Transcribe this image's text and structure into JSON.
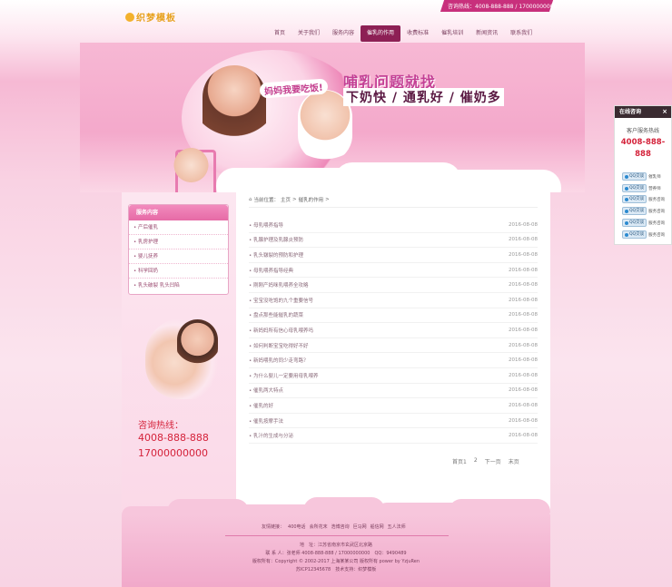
{
  "header": {
    "hotline": "咨询热线：4008-888-888 / 17000000000",
    "logo_text": "织梦模板"
  },
  "nav": [
    {
      "label": "首页"
    },
    {
      "label": "关于我们"
    },
    {
      "label": "服务内容"
    },
    {
      "label": "催乳的作用",
      "active": true
    },
    {
      "label": "收费标准"
    },
    {
      "label": "催乳培训"
    },
    {
      "label": "新闻资讯"
    },
    {
      "label": "联系我们"
    }
  ],
  "banner": {
    "speech": "妈妈我要吃饭!",
    "title": "哺乳问题就找",
    "subtitle": "下奶快 / 通乳好 / 催奶多"
  },
  "sidebar": {
    "title": "服务内容",
    "items": [
      "产后催乳",
      "乳房护理",
      "婴儿抚养",
      "科学回奶",
      "乳头破裂 乳头凹陷"
    ],
    "hotline_label": "咨询热线：",
    "hotline_numbers": [
      "4008-888-888",
      "17000000000"
    ]
  },
  "breadcrumb": {
    "prefix": "当前位置：",
    "home": "主页",
    "sep": ">",
    "current": "催乳的作用",
    "tail": ">"
  },
  "articles": [
    {
      "title": "母乳喂养指导",
      "date": "2016-08-08"
    },
    {
      "title": "乳腺护理及乳腺炎预防",
      "date": "2016-08-08"
    },
    {
      "title": "乳头皲裂的预防和护理",
      "date": "2016-08-08"
    },
    {
      "title": "母乳喂养指导经典",
      "date": "2016-08-08"
    },
    {
      "title": "刚刚产妈咪乳喂养全攻略",
      "date": "2016-08-08"
    },
    {
      "title": "宝宝没吃饱的九个重要信号",
      "date": "2016-08-08"
    },
    {
      "title": "盘点那些能催乳的蔬菜",
      "date": "2016-08-08"
    },
    {
      "title": "新妈妈所有信心母乳喂养吗",
      "date": "2016-08-08"
    },
    {
      "title": "如何判断宝宝吃得好不好",
      "date": "2016-08-08"
    },
    {
      "title": "新妈喂乳的同少走弯路？",
      "date": "2016-08-08"
    },
    {
      "title": "为什么婴儿一定要用母乳喂养",
      "date": "2016-08-08"
    },
    {
      "title": "催乳两大特点",
      "date": "2016-08-08"
    },
    {
      "title": "催乳的好",
      "date": "2016-08-08"
    },
    {
      "title": "催乳按摩手法",
      "date": "2016-08-08"
    },
    {
      "title": "乳汁的生成与分泌",
      "date": "2016-08-08"
    }
  ],
  "pager": {
    "home": "首页",
    "current": "1",
    "page2": "2",
    "next": "下一页",
    "last": "末页"
  },
  "footer": {
    "friend_label": "友情链接：",
    "links": [
      "400电话",
      "会所花末",
      "浩博咨询",
      "巨马网",
      "船信网",
      "五人法师"
    ],
    "address": "地　址：江苏省南京市玄武区北京路",
    "contact": "联 系 人：张老师 4008-888-888 / 17000000000　QQ：9490489",
    "copyright": "版权所有：Copyright © 2002-2017 上海某某公司 版权所有 power by YzjuRen",
    "icp": "苏ICP12345678　技术支持：织梦模板"
  },
  "chat_panel": {
    "title": "在线咨询",
    "close": "×",
    "service_label": "客户服务热线",
    "phone_line1": "4008-888-",
    "phone_line2": "888",
    "qq_button": "QQ交谈",
    "agents": [
      "催乳师",
      "营养师",
      "服务咨询",
      "服务咨询",
      "服务咨询",
      "服务咨询"
    ]
  }
}
